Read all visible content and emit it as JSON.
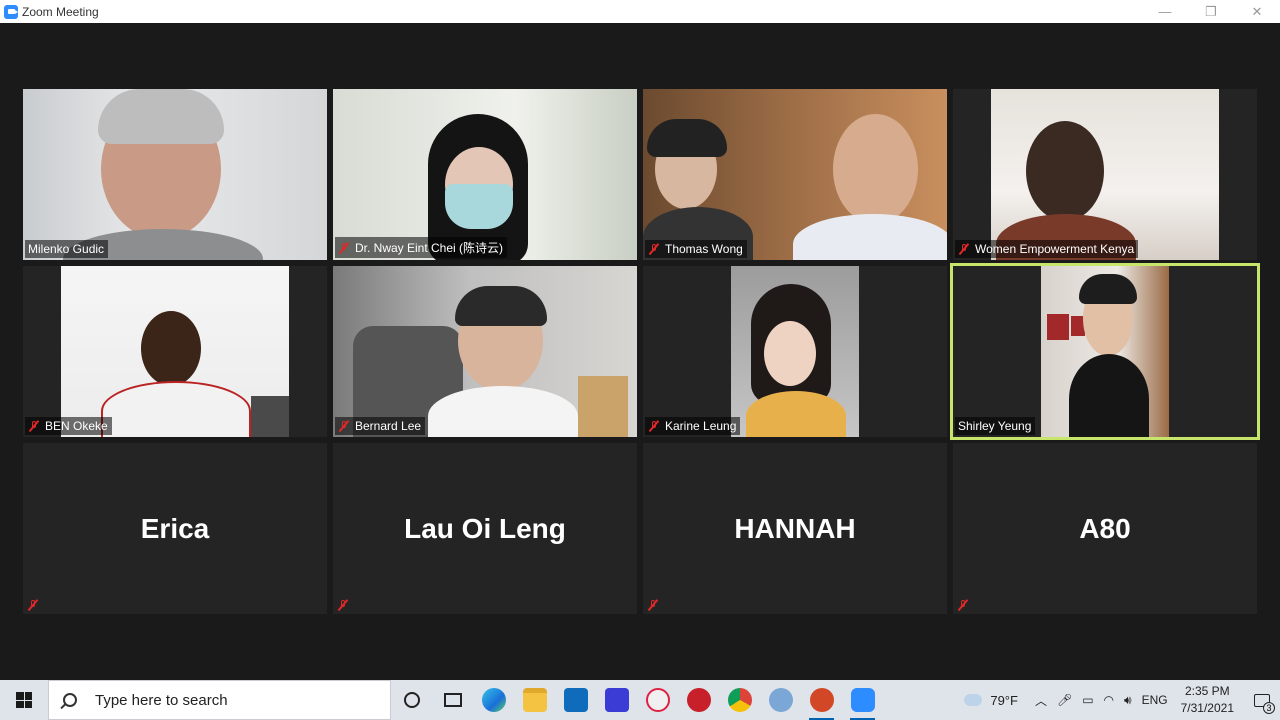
{
  "window": {
    "title": "Zoom Meeting",
    "minimize": "—",
    "restore": "❐",
    "close": "✕"
  },
  "participants": [
    {
      "name": "Milenko Gudic",
      "muted": false
    },
    {
      "name": "Dr. Nway Eint Chei (陈诗云)",
      "muted": true
    },
    {
      "name": "Thomas Wong",
      "muted": true
    },
    {
      "name": "Women Empowerment Kenya",
      "muted": true
    },
    {
      "name": "BEN Okeke",
      "muted": true
    },
    {
      "name": "Bernard Lee",
      "muted": true
    },
    {
      "name": "Karine Leung",
      "muted": true
    },
    {
      "name": "Shirley Yeung",
      "muted": false,
      "active_speaker": true
    },
    {
      "name": "Erica",
      "muted": true,
      "video_off": true
    },
    {
      "name": "Lau Oi Leng",
      "muted": true,
      "video_off": true
    },
    {
      "name": "HANNAH",
      "muted": true,
      "video_off": true
    },
    {
      "name": "A80",
      "muted": true,
      "video_off": true
    }
  ],
  "taskbar": {
    "search_placeholder": "Type here to search",
    "weather_temp": "79°F",
    "language": "ENG",
    "time": "2:35 PM",
    "date": "7/31/2021",
    "notification_count": "3",
    "pinned_icons": [
      "cortana-icon",
      "task-view-icon",
      "edge-icon",
      "file-explorer-icon",
      "mail-icon",
      "app-icon",
      "snip-icon",
      "app-icon",
      "chrome-icon",
      "app-icon",
      "powerpoint-icon",
      "zoom-icon"
    ]
  },
  "colors": {
    "active_speaker_border": "#c7e56b",
    "muted_icon": "#e02828",
    "zoom_blue": "#2d8cff"
  }
}
